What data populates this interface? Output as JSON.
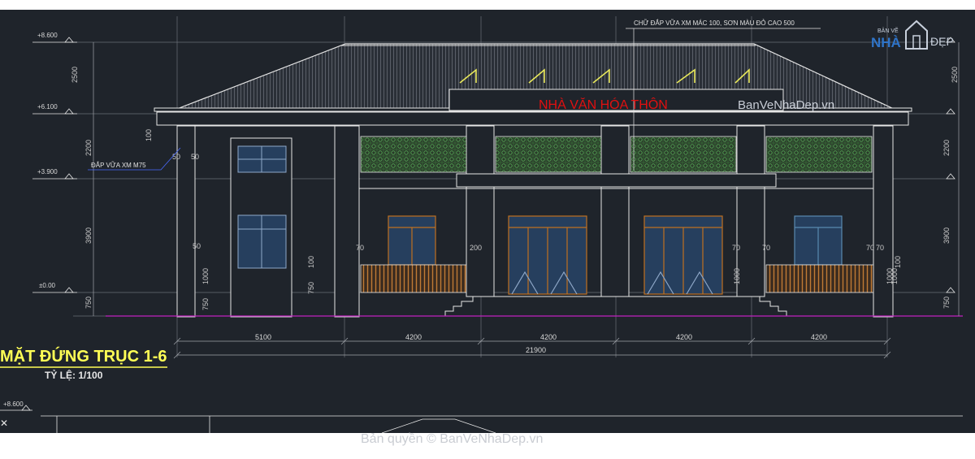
{
  "drawing": {
    "sign_text": "NHÀ VĂN HÓA THÔN",
    "roof_note": "CHỮ ĐẮP VỮA XM MÁC 100, SƠN MÀU ĐỎ CAO 500",
    "plaster_note": "ĐẮP VỮA XM M75",
    "title": "MẶT ĐỨNG TRỤC 1-6",
    "scale": "TỶ LỆ: 1/100",
    "levels": [
      "+8.600",
      "+6.100",
      "+3.900",
      "±0.00",
      "+8.600"
    ],
    "left_vertical_dims": [
      "2500",
      "2200",
      "3900",
      "750"
    ],
    "right_vertical_dims": [
      "2500",
      "2200",
      "3900",
      "750"
    ],
    "bay_dims": [
      "5100",
      "4200",
      "4200",
      "4200",
      "4200"
    ],
    "total_dim": "21900",
    "small_dims": [
      "100",
      "50",
      "50",
      "50",
      "1000",
      "750",
      "100",
      "750",
      "70",
      "200",
      "1000",
      "1000",
      "70",
      "70",
      "70",
      "70",
      "100",
      "1000"
    ]
  },
  "watermarks": {
    "logo_top": "BẢN VẼ",
    "logo_nha": "NHÀ",
    "logo_dep": "ĐẸP",
    "site": "BanVeNhaDep.vn",
    "copyright": "Bản quyền © BanVeNhaDep.vn"
  },
  "colors": {
    "background": "#1f242b",
    "lines": "#e6e6e6",
    "grid": "#6a6f77",
    "ground": "#c020c0",
    "roof_hatch": "#8a8f98",
    "lattice": "#3c7a3c",
    "railing": "#b86a28",
    "door_frame": "#c07020",
    "window_frame": "#5a8ab0",
    "glass": "#263f5e",
    "flag": "#e8e85a",
    "sign": "#e01010",
    "dim_text": "#d8d8d8",
    "title": "#ffff55"
  }
}
